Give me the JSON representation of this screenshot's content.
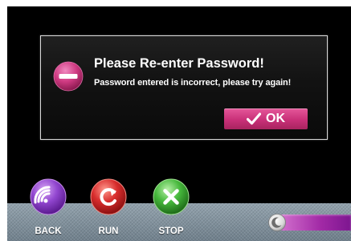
{
  "dialog": {
    "title": "Please Re-enter Password!",
    "message": "Password entered is incorrect, please try again!",
    "ok_label": "OK",
    "icon": "minus-circle-icon"
  },
  "nav": {
    "back_label": "BACK",
    "run_label": "RUN",
    "stop_label": "STOP"
  },
  "slider": {
    "icon": "moon-icon"
  },
  "colors": {
    "screen_bg": "#000000",
    "accent_pink": "#c93078",
    "back_purple": "#8a3fc6",
    "run_red": "#d42a2a",
    "stop_green": "#3faf3a",
    "bar_gray": "#7d8d99"
  }
}
